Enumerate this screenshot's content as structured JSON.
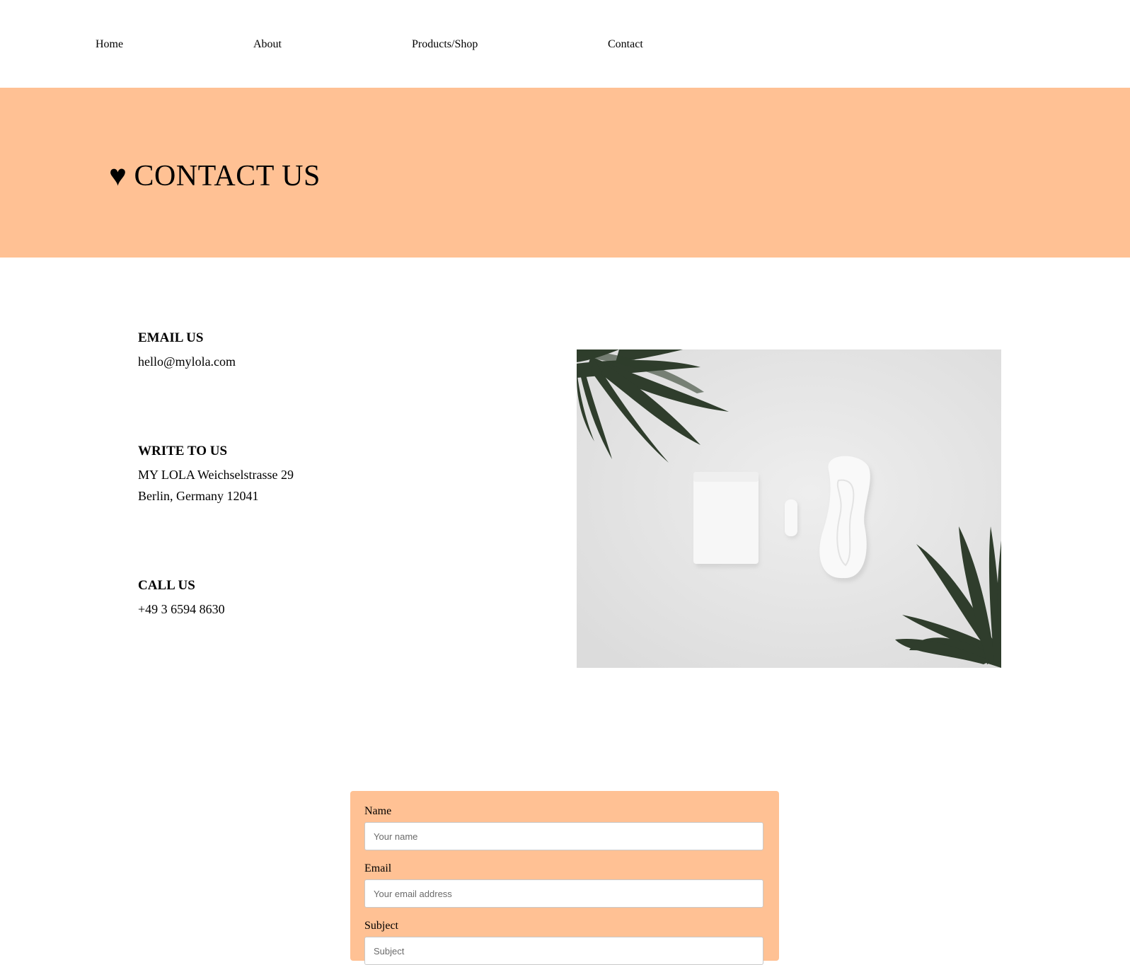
{
  "nav": {
    "items": [
      {
        "label": "Home"
      },
      {
        "label": "About"
      },
      {
        "label": "Products/Shop"
      },
      {
        "label": "Contact"
      }
    ]
  },
  "hero": {
    "heart": "♥",
    "title": "CONTACT US",
    "background": "#ffc194"
  },
  "contact": {
    "email": {
      "heading": "EMAIL US",
      "value": "hello@mylola.com"
    },
    "write": {
      "heading": "WRITE TO US",
      "line1": "MY LOLA Weichselstrasse 29",
      "line2": "Berlin, Germany 12041"
    },
    "call": {
      "heading": "CALL US",
      "value": "+49 3 6594 8630"
    }
  },
  "form": {
    "background": "#ffc194",
    "name": {
      "label": "Name",
      "placeholder": "Your name"
    },
    "email": {
      "label": "Email",
      "placeholder": "Your email address"
    },
    "subject": {
      "label": "Subject",
      "placeholder": "Subject"
    }
  }
}
